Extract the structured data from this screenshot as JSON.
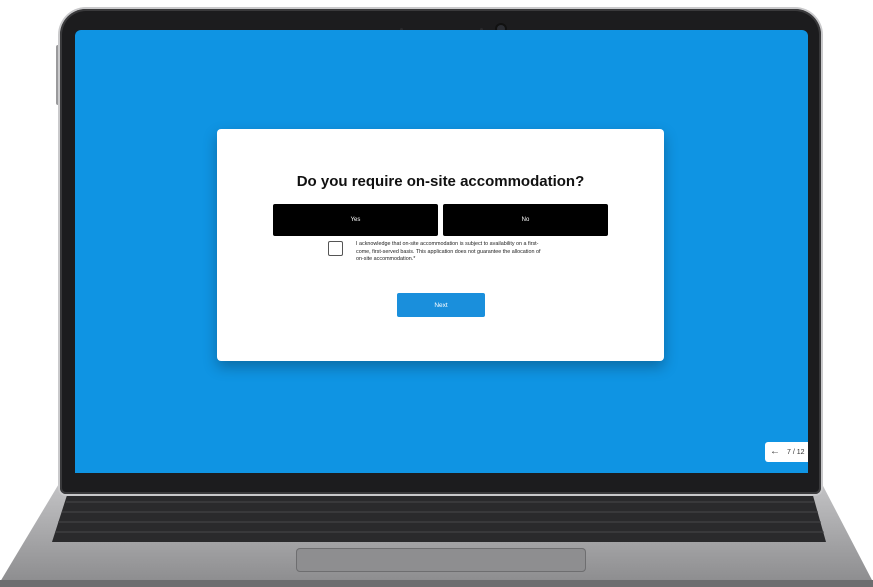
{
  "dialog": {
    "question": "Do you require on-site accommodation?",
    "yes_label": "Yes",
    "no_label": "No",
    "acknowledgement": "I acknowledge that on-site accommodation is subject to availability on a first-come, first-served basis. This application does not guarantee the allocation of on-site accommodation.*",
    "acknowledgement_checked": false,
    "next_label": "Next"
  },
  "pager": {
    "back_icon": "arrow-left-icon",
    "count": "7 / 12"
  },
  "colors": {
    "screen_background": "#0f94e3",
    "choice_button": "#000000",
    "next_button": "#1a8fdc",
    "laptop_bezel": "#1c1c1e",
    "laptop_body": "#a9a9ab"
  }
}
